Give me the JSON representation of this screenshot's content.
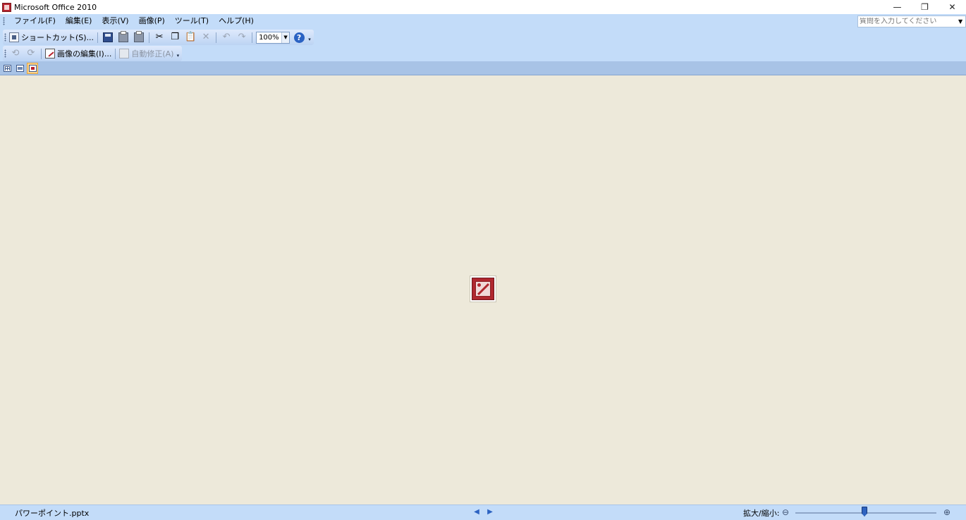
{
  "window": {
    "title": "Microsoft Office 2010",
    "controls": {
      "minimize": "—",
      "restore": "❐",
      "close": "✕"
    }
  },
  "menubar": {
    "items": [
      "ファイル(F)",
      "編集(E)",
      "表示(V)",
      "画像(P)",
      "ツール(T)",
      "ヘルプ(H)"
    ]
  },
  "help_search": {
    "placeholder": "質問を入力してください",
    "dropdown": "▼"
  },
  "toolbar_standard": {
    "shortcut_label": "ショートカット(S)...",
    "zoom_value": "100%",
    "zoom_dropdown": "▼",
    "help": "?",
    "overflow": "▾",
    "cut_glyph": "✂",
    "copy_glyph": "❐",
    "paste_glyph": "📋",
    "delete_glyph": "✕",
    "undo_glyph": "↶",
    "redo_glyph": "↷"
  },
  "toolbar_picture": {
    "rotate_left_glyph": "⟲",
    "rotate_right_glyph": "⟳",
    "edit_picture_label": "画像の編集(I)...",
    "autocorrect_label": "自動修正(A)",
    "overflow": "▾"
  },
  "view_modes": {
    "active": "single"
  },
  "statusbar": {
    "filename": "パワーポイント.pptx",
    "prev": "◀",
    "next": "▶",
    "zoom_label": "拡大/縮小:",
    "zoom_out": "⊖",
    "zoom_in": "⊕",
    "zoom_slider_level": 0.49
  },
  "colors": {
    "commandbar": "#c3dcf9",
    "canvas": "#ede9da",
    "accent": "#b0272f"
  }
}
